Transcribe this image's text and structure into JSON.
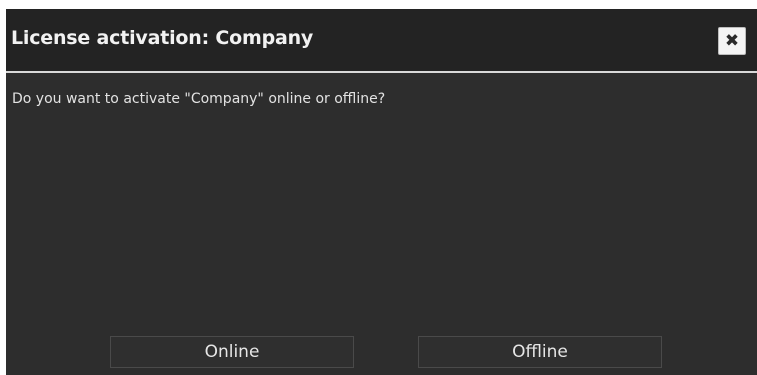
{
  "dialog": {
    "title": "License activation: Company",
    "close_label": "✖",
    "message": "Do you want to activate \"Company\" online or offline?",
    "buttons": {
      "online": "Online",
      "offline": "Offline"
    }
  },
  "colors": {
    "background": "#2d2d2d",
    "titlebar": "#232323",
    "separator": "#d9d9d9",
    "text": "#e2e2e2"
  },
  "icons": {
    "close": "close-icon"
  }
}
